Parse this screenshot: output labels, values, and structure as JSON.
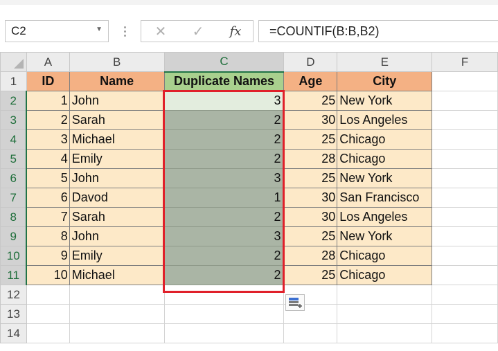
{
  "formula_bar": {
    "name_box": "C2",
    "cancel_symbol": "✕",
    "enter_symbol": "✓",
    "fx_symbol": "fx",
    "formula": "=COUNTIF(B:B,B2)"
  },
  "columns": [
    "A",
    "B",
    "C",
    "D",
    "E",
    "F"
  ],
  "row_numbers": [
    "1",
    "2",
    "3",
    "4",
    "5",
    "6",
    "7",
    "8",
    "9",
    "10",
    "11",
    "12",
    "13",
    "14"
  ],
  "header": {
    "id": "ID",
    "name": "Name",
    "dup": "Duplicate Names",
    "age": "Age",
    "city": "City"
  },
  "rows": [
    {
      "id": "1",
      "name": "John",
      "dup": "3",
      "age": "25",
      "city": "New York"
    },
    {
      "id": "2",
      "name": "Sarah",
      "dup": "2",
      "age": "30",
      "city": "Los Angeles"
    },
    {
      "id": "3",
      "name": "Michael",
      "dup": "2",
      "age": "25",
      "city": "Chicago"
    },
    {
      "id": "4",
      "name": "Emily",
      "dup": "2",
      "age": "28",
      "city": "Chicago"
    },
    {
      "id": "5",
      "name": "John",
      "dup": "3",
      "age": "25",
      "city": "New York"
    },
    {
      "id": "6",
      "name": "Davod",
      "dup": "1",
      "age": "30",
      "city": "San Francisco"
    },
    {
      "id": "7",
      "name": "Sarah",
      "dup": "2",
      "age": "30",
      "city": "Los Angeles"
    },
    {
      "id": "8",
      "name": "John",
      "dup": "3",
      "age": "25",
      "city": "New York"
    },
    {
      "id": "9",
      "name": "Emily",
      "dup": "2",
      "age": "28",
      "city": "Chicago"
    },
    {
      "id": "10",
      "name": "Michael",
      "dup": "2",
      "age": "25",
      "city": "Chicago"
    }
  ],
  "colors": {
    "header_orange": "#f4b184",
    "header_green": "#a9d08e",
    "data_fill": "#fde9c8",
    "selection_fill": "#aab5a5",
    "highlight_border": "#e0202a",
    "excel_green": "#217346"
  },
  "icons": {
    "name_box_dropdown": "chevron-down-icon",
    "quick_analysis": "quick-analysis-icon"
  }
}
